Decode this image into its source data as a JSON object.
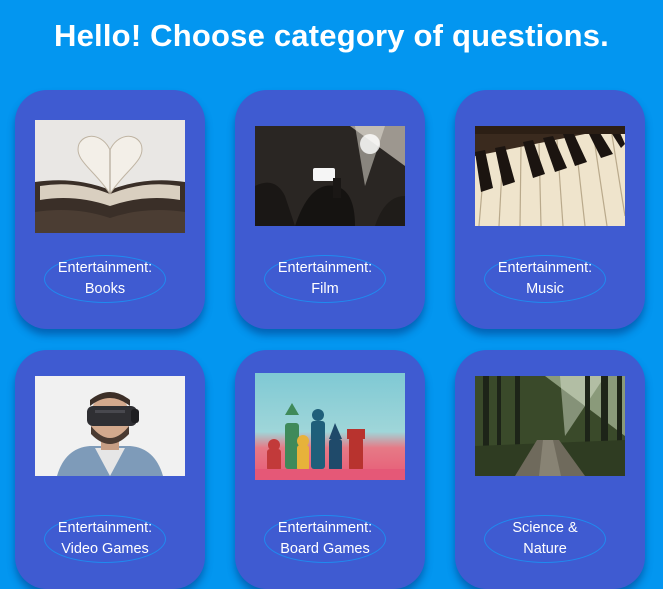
{
  "header": {
    "title": "Hello! Choose category of questions."
  },
  "categories": [
    {
      "line1": "Entertainment:",
      "line2": "Books",
      "image_icon": "open-book-heart-photo"
    },
    {
      "line1": "Entertainment:",
      "line2": "Film",
      "image_icon": "concert-phone-photo"
    },
    {
      "line1": "Entertainment:",
      "line2": "Music",
      "image_icon": "piano-keys-photo"
    },
    {
      "line1": "Entertainment:",
      "line2": "Video Games",
      "image_icon": "vr-headset-photo"
    },
    {
      "line1": "Entertainment:",
      "line2": "Board Games",
      "image_icon": "chess-pieces-photo"
    },
    {
      "line1": "Science &",
      "line2": "Nature",
      "image_icon": "forest-path-photo"
    }
  ],
  "colors": {
    "background": "#0396f0",
    "card": "#3f5bd1",
    "label_border": "#1f8bf0",
    "text": "#ffffff"
  }
}
